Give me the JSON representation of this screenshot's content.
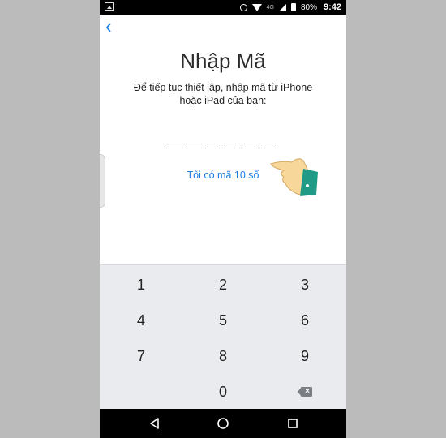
{
  "status_bar": {
    "network": "4G",
    "battery": "80%",
    "time": "9:42"
  },
  "screen": {
    "title": "Nhập Mã",
    "subtitle": "Để tiếp tục thiết lập, nhập mã từ iPhone hoặc iPad của bạn:",
    "code_slots": 6,
    "alt_code_link": "Tôi có mã 10 số"
  },
  "keypad": {
    "keys": [
      "1",
      "2",
      "3",
      "4",
      "5",
      "6",
      "7",
      "8",
      "9",
      "0"
    ]
  },
  "colors": {
    "accent": "#1c7ee6",
    "keypad_bg": "#e9ebee",
    "page_bg": "#bcbbbb"
  },
  "icons": {
    "back": "chevron-left-icon",
    "backspace": "backspace-icon",
    "nav_back": "triangle-back-icon",
    "nav_home": "circle-home-icon",
    "nav_recent": "square-recent-icon"
  }
}
